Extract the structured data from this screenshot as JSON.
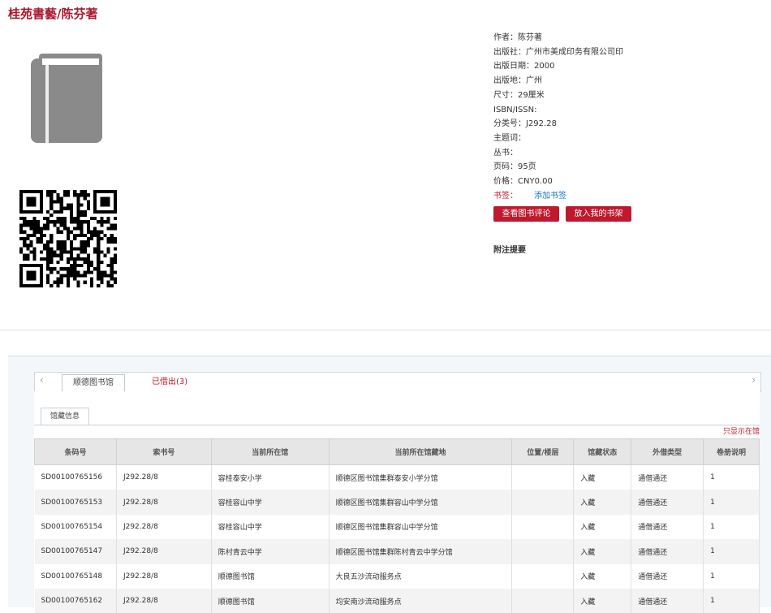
{
  "title": "桂苑書藝/陈芬著",
  "meta": [
    {
      "label": "作者：",
      "value": "陈芬著"
    },
    {
      "label": "出版社：",
      "value": "广州市美成印务有限公司印"
    },
    {
      "label": "出版日期：",
      "value": "2000"
    },
    {
      "label": "出版地：",
      "value": "广州"
    },
    {
      "label": "尺寸：",
      "value": "29厘米"
    },
    {
      "label": "ISBN/ISSN:",
      "value": ""
    },
    {
      "label": "分类号：",
      "value": "J292.28"
    },
    {
      "label": "主题词：",
      "value": ""
    },
    {
      "label": "丛书：",
      "value": ""
    },
    {
      "label": "页码：",
      "value": "95页"
    },
    {
      "label": "价格：",
      "value": "CNY0.00"
    }
  ],
  "bookmark": {
    "label": "书签：",
    "link": "添加书签"
  },
  "buttons": {
    "review": "查看图书评论",
    "shelf": "放入我的书架"
  },
  "note_title": "附注提要",
  "tabs": {
    "active": "顺德图书馆",
    "other": "已借出(3)"
  },
  "subtab": "馆藏信息",
  "only_show": "只显示在馆",
  "table": {
    "headers": [
      "条码号",
      "索书号",
      "当前所在馆",
      "当前所在馆藏地",
      "位置/楼层",
      "馆藏状态",
      "外借类型",
      "卷册说明"
    ],
    "rows": [
      [
        "SD00100765156",
        "J292.28/8",
        "容桂泰安小学",
        "顺德区图书馆集群泰安小学分馆",
        "",
        "入藏",
        "通借通还",
        "1"
      ],
      [
        "SD00100765153",
        "J292.28/8",
        "容桂容山中学",
        "顺德区图书馆集群容山中学分馆",
        "",
        "入藏",
        "通借通还",
        "1"
      ],
      [
        "SD00100765154",
        "J292.28/8",
        "容桂容山中学",
        "顺德区图书馆集群容山中学分馆",
        "",
        "入藏",
        "通借通还",
        "1"
      ],
      [
        "SD00100765147",
        "J292.28/8",
        "陈村青云中学",
        "顺德区图书馆集群陈村青云中学分馆",
        "",
        "入藏",
        "通借通还",
        "1"
      ],
      [
        "SD00100765148",
        "J292.28/8",
        "顺德图书馆",
        "大良五沙流动服务点",
        "",
        "入藏",
        "通借通还",
        "1"
      ],
      [
        "SD00100765162",
        "J292.28/8",
        "顺德图书馆",
        "均安南沙流动服务点",
        "",
        "入藏",
        "通借通还",
        "1"
      ]
    ]
  }
}
